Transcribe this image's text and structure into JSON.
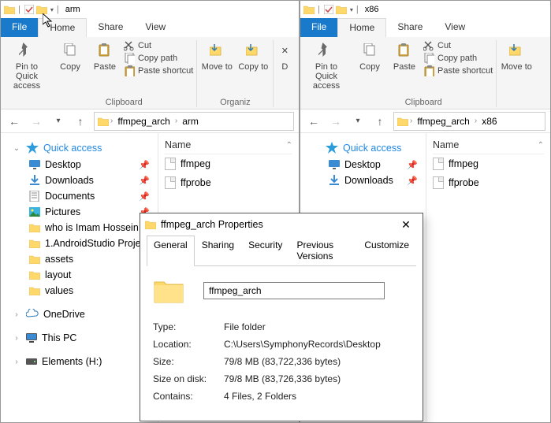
{
  "left_window": {
    "title": "arm",
    "menu": {
      "file": "File",
      "home": "Home",
      "share": "Share",
      "view": "View"
    },
    "ribbon": {
      "pin": "Pin to Quick access",
      "copy": "Copy",
      "paste": "Paste",
      "cut": "Cut",
      "copy_path": "Copy path",
      "paste_shortcut": "Paste shortcut",
      "clipboard_label": "Clipboard",
      "move_to": "Move to",
      "copy_to": "Copy to",
      "delete": "D",
      "organize_label": "Organiz"
    },
    "breadcrumbs": [
      "ffmpeg_arch",
      "arm"
    ],
    "nav": {
      "quick_access": "Quick access",
      "items": [
        {
          "label": "Desktop",
          "pinned": true
        },
        {
          "label": "Downloads",
          "pinned": true
        },
        {
          "label": "Documents",
          "pinned": true
        },
        {
          "label": "Pictures",
          "pinned": true
        },
        {
          "label": "who is Imam Hossein",
          "pinned": false
        },
        {
          "label": "1.AndroidStudio Proje",
          "pinned": false
        },
        {
          "label": "assets",
          "pinned": false
        },
        {
          "label": "layout",
          "pinned": false
        },
        {
          "label": "values",
          "pinned": false
        }
      ],
      "onedrive": "OneDrive",
      "thispc": "This PC",
      "elements": "Elements (H:)"
    },
    "content": {
      "name_header": "Name",
      "files": [
        "ffmpeg",
        "ffprobe"
      ]
    }
  },
  "right_window": {
    "title": "x86",
    "menu": {
      "file": "File",
      "home": "Home",
      "share": "Share",
      "view": "View"
    },
    "ribbon": {
      "pin": "Pin to Quick access",
      "copy": "Copy",
      "paste": "Paste",
      "cut": "Cut",
      "copy_path": "Copy path",
      "paste_shortcut": "Paste shortcut",
      "clipboard_label": "Clipboard",
      "move_to": "Move to"
    },
    "breadcrumbs": [
      "ffmpeg_arch",
      "x86"
    ],
    "nav": {
      "quick_access": "Quick access",
      "items": [
        {
          "label": "Desktop",
          "pinned": true
        },
        {
          "label": "Downloads",
          "pinned": true
        }
      ]
    },
    "content": {
      "name_header": "Name",
      "files": [
        "ffmpeg",
        "ffprobe"
      ]
    }
  },
  "properties": {
    "title": "ffmpeg_arch Properties",
    "tabs": [
      "General",
      "Sharing",
      "Security",
      "Previous Versions",
      "Customize"
    ],
    "name_value": "ffmpeg_arch",
    "rows": {
      "type_k": "Type:",
      "type_v": "File folder",
      "location_k": "Location:",
      "location_v": "C:\\Users\\SymphonyRecords\\Desktop",
      "size_k": "Size:",
      "size_v": "79/8 MB (83,722,336 bytes)",
      "disk_k": "Size on disk:",
      "disk_v": "79/8 MB (83,726,336 bytes)",
      "contains_k": "Contains:",
      "contains_v": "4 Files, 2 Folders"
    }
  }
}
